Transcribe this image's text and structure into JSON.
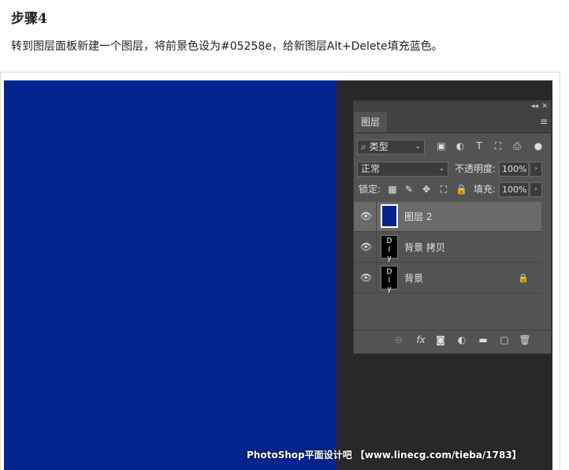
{
  "article": {
    "step_title": "步骤4",
    "step_desc": "转到图层面板新建一个图层，将前景色设为#05258e，给新图层Alt+Delete填充蓝色。"
  },
  "canvas": {
    "fill_color": "#05258e"
  },
  "panel": {
    "collapse_glyph": "◂◂",
    "close_glyph": "✕",
    "tab_label": "图层",
    "menu_glyph": "≡",
    "filter": {
      "kind_label": "类型",
      "search_glyph": "⌕",
      "arrow": "⌄",
      "icons": [
        "▣",
        "◐",
        "T",
        "⛶",
        "⎙"
      ],
      "toggle_glyph": "●"
    },
    "blend": {
      "mode": "正常",
      "arrow": "⌄",
      "opacity_label": "不透明度:",
      "opacity_value": "100%",
      "opacity_arrow": "›"
    },
    "lock": {
      "label": "锁定:",
      "icons": [
        "▦",
        "✎",
        "✥",
        "⛶",
        "🔒"
      ],
      "fill_label": "填充:",
      "fill_value": "100%",
      "fill_arrow": "›"
    },
    "layers": [
      {
        "name": "图层 2",
        "visible_glyph": "👁",
        "thumb": "blue",
        "selected": true
      },
      {
        "name": "背景 拷贝",
        "visible_glyph": "👁",
        "thumb": "black",
        "thumb_glyph": "D\nI\ny",
        "selected": false
      },
      {
        "name": "背景",
        "visible_glyph": "👁",
        "thumb": "black",
        "thumb_glyph": "D\nI\ny",
        "lock_glyph": "🔒",
        "selected": false
      }
    ],
    "bottom_icons": [
      "⊖",
      "fx",
      "◙",
      "◐",
      "▬",
      "▢",
      "🗑"
    ]
  },
  "watermark": "PhotoShop平面设计吧 【www.linecg.com/tieba/1783】"
}
